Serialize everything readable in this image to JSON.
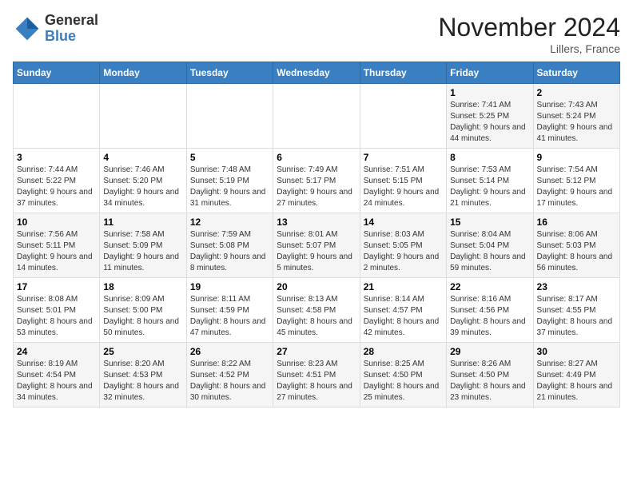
{
  "header": {
    "logo_general": "General",
    "logo_blue": "Blue",
    "month_title": "November 2024",
    "location": "Lillers, France"
  },
  "days_of_week": [
    "Sunday",
    "Monday",
    "Tuesday",
    "Wednesday",
    "Thursday",
    "Friday",
    "Saturday"
  ],
  "weeks": [
    [
      {
        "day": "",
        "sunrise": "",
        "sunset": "",
        "daylight": ""
      },
      {
        "day": "",
        "sunrise": "",
        "sunset": "",
        "daylight": ""
      },
      {
        "day": "",
        "sunrise": "",
        "sunset": "",
        "daylight": ""
      },
      {
        "day": "",
        "sunrise": "",
        "sunset": "",
        "daylight": ""
      },
      {
        "day": "",
        "sunrise": "",
        "sunset": "",
        "daylight": ""
      },
      {
        "day": "1",
        "sunrise": "Sunrise: 7:41 AM",
        "sunset": "Sunset: 5:25 PM",
        "daylight": "Daylight: 9 hours and 44 minutes."
      },
      {
        "day": "2",
        "sunrise": "Sunrise: 7:43 AM",
        "sunset": "Sunset: 5:24 PM",
        "daylight": "Daylight: 9 hours and 41 minutes."
      }
    ],
    [
      {
        "day": "3",
        "sunrise": "Sunrise: 7:44 AM",
        "sunset": "Sunset: 5:22 PM",
        "daylight": "Daylight: 9 hours and 37 minutes."
      },
      {
        "day": "4",
        "sunrise": "Sunrise: 7:46 AM",
        "sunset": "Sunset: 5:20 PM",
        "daylight": "Daylight: 9 hours and 34 minutes."
      },
      {
        "day": "5",
        "sunrise": "Sunrise: 7:48 AM",
        "sunset": "Sunset: 5:19 PM",
        "daylight": "Daylight: 9 hours and 31 minutes."
      },
      {
        "day": "6",
        "sunrise": "Sunrise: 7:49 AM",
        "sunset": "Sunset: 5:17 PM",
        "daylight": "Daylight: 9 hours and 27 minutes."
      },
      {
        "day": "7",
        "sunrise": "Sunrise: 7:51 AM",
        "sunset": "Sunset: 5:15 PM",
        "daylight": "Daylight: 9 hours and 24 minutes."
      },
      {
        "day": "8",
        "sunrise": "Sunrise: 7:53 AM",
        "sunset": "Sunset: 5:14 PM",
        "daylight": "Daylight: 9 hours and 21 minutes."
      },
      {
        "day": "9",
        "sunrise": "Sunrise: 7:54 AM",
        "sunset": "Sunset: 5:12 PM",
        "daylight": "Daylight: 9 hours and 17 minutes."
      }
    ],
    [
      {
        "day": "10",
        "sunrise": "Sunrise: 7:56 AM",
        "sunset": "Sunset: 5:11 PM",
        "daylight": "Daylight: 9 hours and 14 minutes."
      },
      {
        "day": "11",
        "sunrise": "Sunrise: 7:58 AM",
        "sunset": "Sunset: 5:09 PM",
        "daylight": "Daylight: 9 hours and 11 minutes."
      },
      {
        "day": "12",
        "sunrise": "Sunrise: 7:59 AM",
        "sunset": "Sunset: 5:08 PM",
        "daylight": "Daylight: 9 hours and 8 minutes."
      },
      {
        "day": "13",
        "sunrise": "Sunrise: 8:01 AM",
        "sunset": "Sunset: 5:07 PM",
        "daylight": "Daylight: 9 hours and 5 minutes."
      },
      {
        "day": "14",
        "sunrise": "Sunrise: 8:03 AM",
        "sunset": "Sunset: 5:05 PM",
        "daylight": "Daylight: 9 hours and 2 minutes."
      },
      {
        "day": "15",
        "sunrise": "Sunrise: 8:04 AM",
        "sunset": "Sunset: 5:04 PM",
        "daylight": "Daylight: 8 hours and 59 minutes."
      },
      {
        "day": "16",
        "sunrise": "Sunrise: 8:06 AM",
        "sunset": "Sunset: 5:03 PM",
        "daylight": "Daylight: 8 hours and 56 minutes."
      }
    ],
    [
      {
        "day": "17",
        "sunrise": "Sunrise: 8:08 AM",
        "sunset": "Sunset: 5:01 PM",
        "daylight": "Daylight: 8 hours and 53 minutes."
      },
      {
        "day": "18",
        "sunrise": "Sunrise: 8:09 AM",
        "sunset": "Sunset: 5:00 PM",
        "daylight": "Daylight: 8 hours and 50 minutes."
      },
      {
        "day": "19",
        "sunrise": "Sunrise: 8:11 AM",
        "sunset": "Sunset: 4:59 PM",
        "daylight": "Daylight: 8 hours and 47 minutes."
      },
      {
        "day": "20",
        "sunrise": "Sunrise: 8:13 AM",
        "sunset": "Sunset: 4:58 PM",
        "daylight": "Daylight: 8 hours and 45 minutes."
      },
      {
        "day": "21",
        "sunrise": "Sunrise: 8:14 AM",
        "sunset": "Sunset: 4:57 PM",
        "daylight": "Daylight: 8 hours and 42 minutes."
      },
      {
        "day": "22",
        "sunrise": "Sunrise: 8:16 AM",
        "sunset": "Sunset: 4:56 PM",
        "daylight": "Daylight: 8 hours and 39 minutes."
      },
      {
        "day": "23",
        "sunrise": "Sunrise: 8:17 AM",
        "sunset": "Sunset: 4:55 PM",
        "daylight": "Daylight: 8 hours and 37 minutes."
      }
    ],
    [
      {
        "day": "24",
        "sunrise": "Sunrise: 8:19 AM",
        "sunset": "Sunset: 4:54 PM",
        "daylight": "Daylight: 8 hours and 34 minutes."
      },
      {
        "day": "25",
        "sunrise": "Sunrise: 8:20 AM",
        "sunset": "Sunset: 4:53 PM",
        "daylight": "Daylight: 8 hours and 32 minutes."
      },
      {
        "day": "26",
        "sunrise": "Sunrise: 8:22 AM",
        "sunset": "Sunset: 4:52 PM",
        "daylight": "Daylight: 8 hours and 30 minutes."
      },
      {
        "day": "27",
        "sunrise": "Sunrise: 8:23 AM",
        "sunset": "Sunset: 4:51 PM",
        "daylight": "Daylight: 8 hours and 27 minutes."
      },
      {
        "day": "28",
        "sunrise": "Sunrise: 8:25 AM",
        "sunset": "Sunset: 4:50 PM",
        "daylight": "Daylight: 8 hours and 25 minutes."
      },
      {
        "day": "29",
        "sunrise": "Sunrise: 8:26 AM",
        "sunset": "Sunset: 4:50 PM",
        "daylight": "Daylight: 8 hours and 23 minutes."
      },
      {
        "day": "30",
        "sunrise": "Sunrise: 8:27 AM",
        "sunset": "Sunset: 4:49 PM",
        "daylight": "Daylight: 8 hours and 21 minutes."
      }
    ]
  ]
}
